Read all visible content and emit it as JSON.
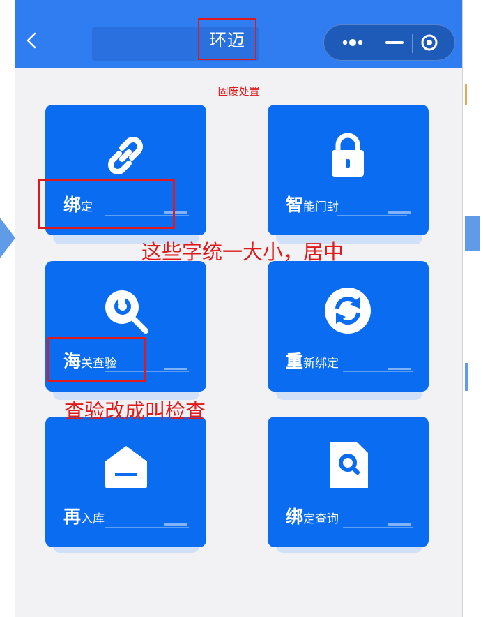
{
  "header": {
    "title": "环迈"
  },
  "subtitle": "固废处置",
  "tiles": [
    {
      "lead": "绑",
      "rest": "定",
      "icon": "link-icon"
    },
    {
      "lead": "智",
      "rest": "能门封",
      "icon": "lock-icon"
    },
    {
      "lead": "海",
      "rest": "关查验",
      "icon": "search-icon"
    },
    {
      "lead": "重",
      "rest": "新绑定",
      "icon": "refresh-icon"
    },
    {
      "lead": "再",
      "rest": "入库",
      "icon": "warehouse-icon"
    },
    {
      "lead": "绑",
      "rest": "定查询",
      "icon": "search-document-icon"
    }
  ],
  "annotations": {
    "note_size": "这些字统一大小，居中",
    "note_rename": "查验改成叫检查"
  },
  "colors": {
    "header": "#2f7df0",
    "tile": "#0a6cf0",
    "annotation": "#e01a1a",
    "background": "#f2f2f4"
  }
}
